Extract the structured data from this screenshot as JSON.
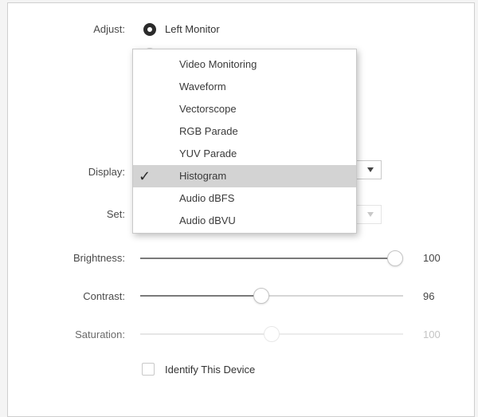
{
  "adjust": {
    "label": "Adjust:",
    "options": [
      {
        "label": "Left Monitor",
        "selected": true
      }
    ]
  },
  "display": {
    "label": "Display:",
    "selected": "Histogram"
  },
  "set": {
    "label": "Set:"
  },
  "dropdown": {
    "items": [
      {
        "label": "Video Monitoring",
        "selected": false
      },
      {
        "label": "Waveform",
        "selected": false
      },
      {
        "label": "Vectorscope",
        "selected": false
      },
      {
        "label": "RGB Parade",
        "selected": false
      },
      {
        "label": "YUV Parade",
        "selected": false
      },
      {
        "label": "Histogram",
        "selected": true
      },
      {
        "label": "Audio dBFS",
        "selected": false
      },
      {
        "label": "Audio dBVU",
        "selected": false
      }
    ],
    "checkmark": "✓"
  },
  "sliders": {
    "brightness": {
      "label": "Brightness:",
      "value": "100",
      "level": 1.0
    },
    "contrast": {
      "label": "Contrast:",
      "value": "96",
      "level": 0.46
    },
    "saturation": {
      "label": "Saturation:",
      "value": "100",
      "level": 0.5,
      "disabled": true
    }
  },
  "identify": {
    "label": "Identify This Device",
    "checked": false
  },
  "colors": {
    "selected_row": "#d3d3d3",
    "panel_border": "#cfcfcf"
  }
}
